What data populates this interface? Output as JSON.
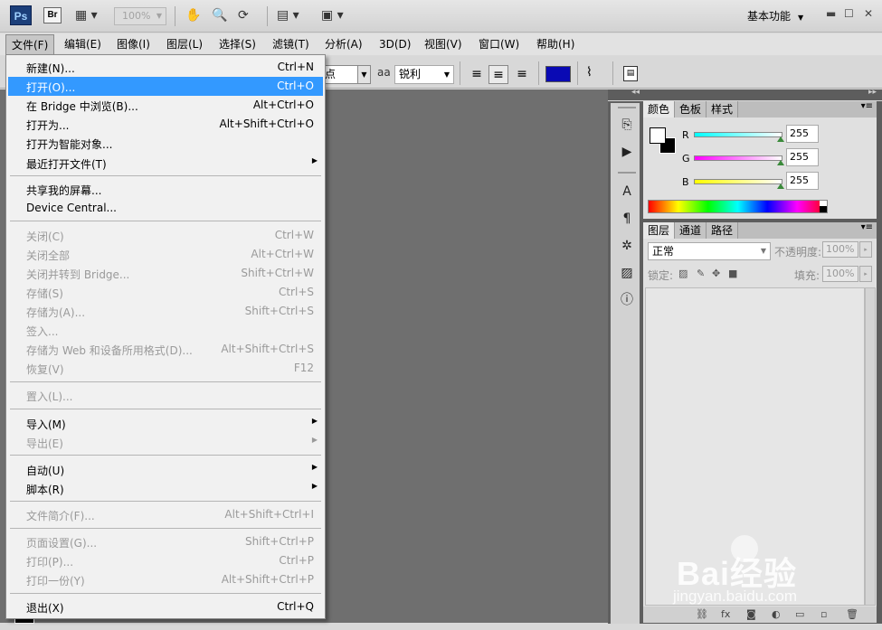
{
  "app": {
    "logo": "Ps",
    "bridge": "Br",
    "zoom": "100%",
    "workspace": "基本功能"
  },
  "menubar": [
    {
      "label": "文件(F)"
    },
    {
      "label": "编辑(E)"
    },
    {
      "label": "图像(I)"
    },
    {
      "label": "图层(L)"
    },
    {
      "label": "选择(S)"
    },
    {
      "label": "滤镜(T)"
    },
    {
      "label": "分析(A)"
    },
    {
      "label": "3D(D)"
    },
    {
      "label": "视图(V)"
    },
    {
      "label": "窗口(W)"
    },
    {
      "label": "帮助(H)"
    }
  ],
  "options": {
    "font_style": "点",
    "aa_icon": "aa",
    "antialias": "锐利",
    "text_color": "#0a0ab4"
  },
  "file_menu": [
    {
      "label": "新建(N)...",
      "shortcut": "Ctrl+N"
    },
    {
      "label": "打开(O)...",
      "shortcut": "Ctrl+O",
      "highlighted": true
    },
    {
      "label": "在 Bridge 中浏览(B)...",
      "shortcut": "Alt+Ctrl+O"
    },
    {
      "label": "打开为...",
      "shortcut": "Alt+Shift+Ctrl+O"
    },
    {
      "label": "打开为智能对象..."
    },
    {
      "label": "最近打开文件(T)",
      "submenu": true
    },
    {
      "label": "共享我的屏幕..."
    },
    {
      "label": "Device Central..."
    },
    {
      "label": "关闭(C)",
      "shortcut": "Ctrl+W",
      "disabled": true
    },
    {
      "label": "关闭全部",
      "shortcut": "Alt+Ctrl+W",
      "disabled": true
    },
    {
      "label": "关闭并转到 Bridge...",
      "shortcut": "Shift+Ctrl+W",
      "disabled": true
    },
    {
      "label": "存储(S)",
      "shortcut": "Ctrl+S",
      "disabled": true
    },
    {
      "label": "存储为(A)...",
      "shortcut": "Shift+Ctrl+S",
      "disabled": true
    },
    {
      "label": "签入...",
      "disabled": true
    },
    {
      "label": "存储为 Web 和设备所用格式(D)...",
      "shortcut": "Alt+Shift+Ctrl+S",
      "disabled": true
    },
    {
      "label": "恢复(V)",
      "shortcut": "F12",
      "disabled": true
    },
    {
      "label": "置入(L)...",
      "disabled": true
    },
    {
      "label": "导入(M)",
      "submenu": true
    },
    {
      "label": "导出(E)",
      "submenu": true,
      "disabled": true
    },
    {
      "label": "自动(U)",
      "submenu": true
    },
    {
      "label": "脚本(R)",
      "submenu": true
    },
    {
      "label": "文件简介(F)...",
      "shortcut": "Alt+Shift+Ctrl+I",
      "disabled": true
    },
    {
      "label": "页面设置(G)...",
      "shortcut": "Shift+Ctrl+P",
      "disabled": true
    },
    {
      "label": "打印(P)...",
      "shortcut": "Ctrl+P",
      "disabled": true
    },
    {
      "label": "打印一份(Y)",
      "shortcut": "Alt+Shift+Ctrl+P",
      "disabled": true
    },
    {
      "label": "退出(X)",
      "shortcut": "Ctrl+Q"
    }
  ],
  "color_panel": {
    "tabs": [
      "颜色",
      "色板",
      "样式"
    ],
    "channels": [
      {
        "label": "R",
        "value": "255"
      },
      {
        "label": "G",
        "value": "255"
      },
      {
        "label": "B",
        "value": "255"
      }
    ]
  },
  "layers_panel": {
    "tabs": [
      "图层",
      "通道",
      "路径"
    ],
    "blend_mode": "正常",
    "opacity_label": "不透明度:",
    "opacity": "100%",
    "lock_label": "锁定:",
    "fill_label": "填充:",
    "fill": "100%"
  },
  "watermark": {
    "brand": "Bai经验",
    "url": "jingyan.baidu.com"
  }
}
